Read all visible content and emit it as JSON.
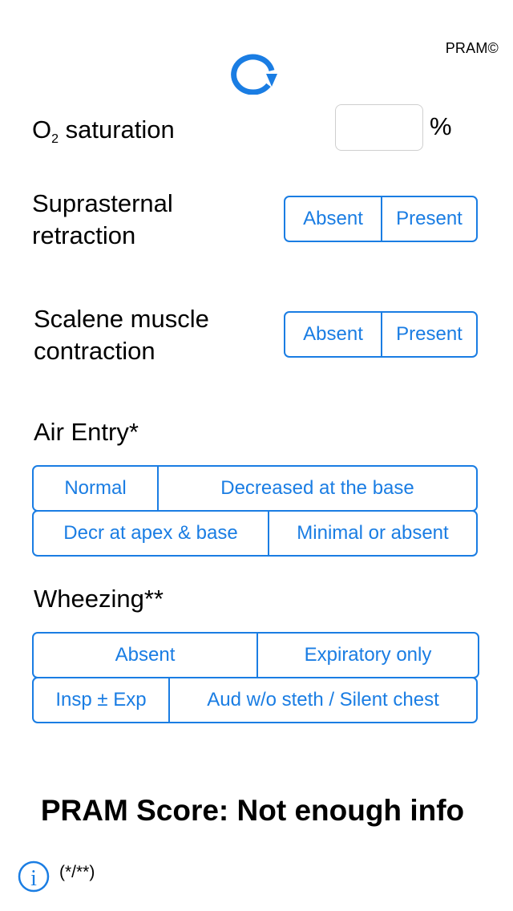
{
  "app": {
    "brand": "PRAM©"
  },
  "icons": {
    "refresh": "refresh-icon",
    "info": "info-icon"
  },
  "colors": {
    "accent": "#1a7de3",
    "text": "#000000",
    "input_border": "#cfcfcf"
  },
  "o2": {
    "label_main": "O",
    "label_sub": "2",
    "label_rest": " saturation",
    "value": "",
    "unit": "%"
  },
  "suprasternal": {
    "label_line1": "Suprasternal",
    "label_line2": "retraction",
    "options": [
      "Absent",
      "Present"
    ]
  },
  "scalene": {
    "label_line1": "Scalene muscle",
    "label_line2": "contraction",
    "options": [
      "Absent",
      "Present"
    ]
  },
  "air_entry": {
    "label": "Air Entry*",
    "row1": [
      "Normal",
      "Decreased at the base"
    ],
    "row2": [
      "Decr at apex & base",
      "Minimal or absent"
    ]
  },
  "wheezing": {
    "label": "Wheezing**",
    "row1": [
      "Absent",
      "Expiratory only"
    ],
    "row2": [
      "Insp ± Exp",
      "Aud w/o steth / Silent chest"
    ]
  },
  "result": {
    "score_text": "PRAM Score: Not enough info"
  },
  "footer": {
    "note": "(*/**)"
  }
}
